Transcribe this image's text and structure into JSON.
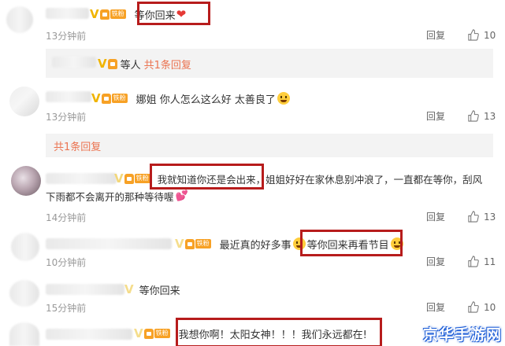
{
  "comments": [
    {
      "text": "等你回来",
      "time": "13分钟前",
      "reply": "回复",
      "likes": "10"
    },
    {
      "text": "娜姐 你人怎么这么好 太善良了",
      "time": "13分钟前",
      "reply": "回复",
      "likes": "13",
      "reply_preview": {
        "text": "等人",
        "count_label": "共1条回复"
      }
    },
    {
      "text_line1": "我就知道你还是会出来，姐姐好好在家休息别冲浪了，一直都在等你，刮风",
      "text_line2": "下雨都不会离开的那种等待喔",
      "time": "14分钟前",
      "reply": "回复",
      "likes": "13",
      "reply_count_label": "共1条回复"
    },
    {
      "text": "最近真的好多事",
      "text_boxed": "等你回来再看节目",
      "time": "10分钟前",
      "reply": "回复",
      "likes": "11"
    },
    {
      "text": "等你回来",
      "time": "15分钟前",
      "reply": "回复",
      "likes": "10"
    },
    {
      "text": "我想你啊！太阳女神！！！我们永远都在!"
    }
  ],
  "badge": {
    "v": "V",
    "fan_tag": "铁粉"
  },
  "watermark": "京华手游网",
  "colors": {
    "highlight_box": "#b71c1c",
    "accent": "#eb7350",
    "fan_badge": "#f7a125"
  }
}
